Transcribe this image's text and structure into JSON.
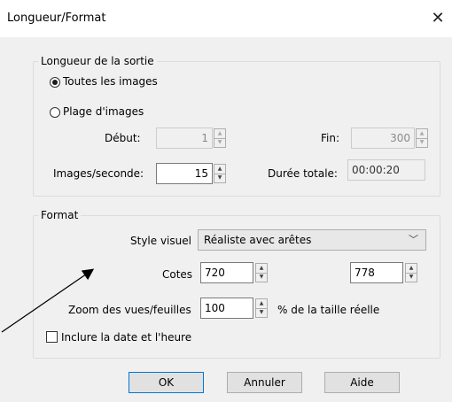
{
  "window": {
    "title": "Longueur/Format",
    "close_glyph": "✕"
  },
  "length_group": {
    "legend": "Longueur de la sortie",
    "all_images_label": "Toutes les images",
    "range_label": "Plage d'images",
    "start_label": "Début:",
    "start_value": "1",
    "end_label": "Fin:",
    "end_value": "300",
    "fps_label": "Images/seconde:",
    "fps_value": "15",
    "duration_label": "Durée totale:",
    "duration_value": "00:00:20",
    "selected_option": "all_images"
  },
  "format_group": {
    "legend": "Format",
    "visual_style_label": "Style visuel",
    "visual_style_value": "Réaliste avec arêtes",
    "dims_label": "Cotes",
    "width_value": "720",
    "height_value": "778",
    "zoom_label": "Zoom des vues/feuilles",
    "zoom_value": "100",
    "zoom_unit": "% de la taille réelle",
    "include_datetime_label": "Inclure la date et l'heure",
    "include_datetime_checked": false
  },
  "buttons": {
    "ok": "OK",
    "cancel": "Annuler",
    "help": "Aide"
  },
  "icons": {
    "spin_up": "▲",
    "spin_down": "▼",
    "dropdown": "﹀"
  }
}
